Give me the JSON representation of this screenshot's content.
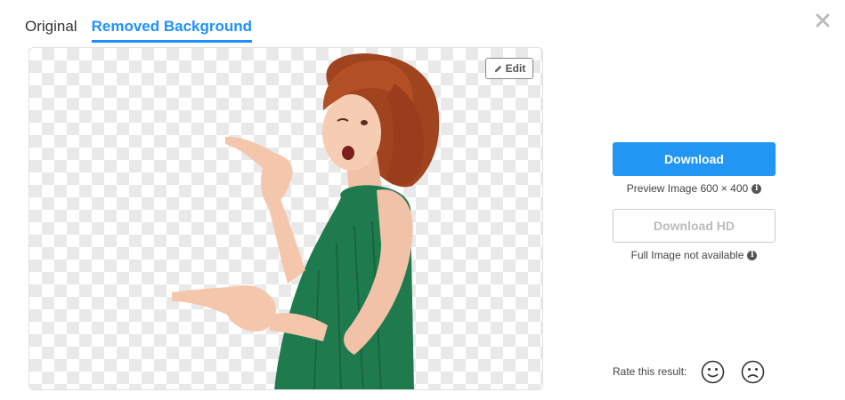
{
  "tabs": [
    {
      "label": "Original",
      "active": false
    },
    {
      "label": "Removed Background",
      "active": true
    }
  ],
  "preview": {
    "edit_label": "Edit"
  },
  "actions": {
    "download_label": "Download",
    "preview_note": "Preview Image 600 × 400",
    "download_hd_label": "Download HD",
    "hd_note": "Full Image not available"
  },
  "rating": {
    "label": "Rate this result:"
  },
  "colors": {
    "accent": "#2196f3",
    "tab_active": "#1e90ff",
    "dress": "#1f7a4d",
    "hair": "#a0431f"
  }
}
